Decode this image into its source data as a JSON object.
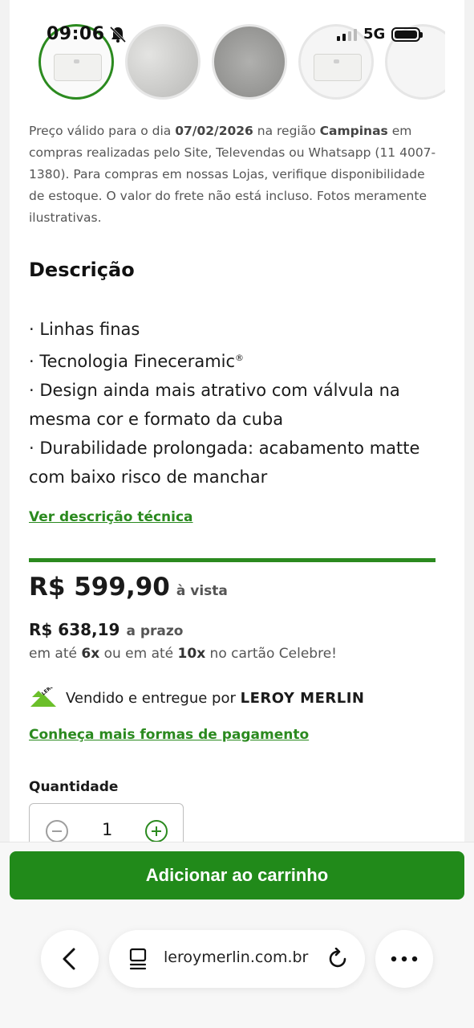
{
  "status_bar": {
    "time": "09:06",
    "network": "5G",
    "icons": [
      "bell-muted-icon",
      "signal-icon",
      "battery-icon"
    ]
  },
  "product": {
    "thumbnails": [
      {
        "name": "thumbnail-1",
        "state": "selected"
      },
      {
        "name": "thumbnail-2",
        "state": "default"
      },
      {
        "name": "thumbnail-3",
        "state": "default"
      },
      {
        "name": "thumbnail-4",
        "state": "default"
      },
      {
        "name": "thumbnail-5",
        "state": "default"
      }
    ],
    "disclaimer": {
      "p1": "Preço válido para o dia ",
      "date": "07/02/2026",
      "p2": " na região ",
      "region": "Campinas",
      "p3": " em compras realizadas pelo Site, Televendas ou Whatsapp (11 4007-1380). Para compras em nossas Lojas, verifique disponibilidade de estoque. O valor do frete não está incluso. Fotos meramente ilustrativas."
    },
    "description": {
      "title": "Descrição",
      "items": [
        "· Linhas finas",
        "· Tecnologia Fineceramic",
        "· Design ainda mais atrativo com válvula na mesma cor e formato da cuba",
        "· Durabilidade prolongada: acabamento matte com baixo risco de manchar"
      ],
      "registered_mark": "®",
      "tech_link": "Ver descrição técnica"
    },
    "pricing": {
      "cash_price": "R$ 599,90",
      "cash_label": "à vista",
      "term_price": "R$ 638,19",
      "term_label": "a prazo",
      "installments_p1": "em até ",
      "installments_n1": "6x",
      "installments_p2": " ou em até ",
      "installments_n2": "10x",
      "installments_p3": " no cartão Celebre!"
    },
    "seller": {
      "text": "Vendido e entregue por ",
      "brand": "LEROY MERLIN",
      "logo_text": "LEROY MERLIN"
    },
    "payment_link": "Conheça mais formas de pagamento",
    "quantity": {
      "label": "Quantidade",
      "value": "1"
    },
    "cart_button": "Adicionar ao carrinho"
  },
  "browser": {
    "url": "leroymerlin.com.br"
  },
  "colors": {
    "accent": "#2b8a1f",
    "button": "#218a1a"
  }
}
